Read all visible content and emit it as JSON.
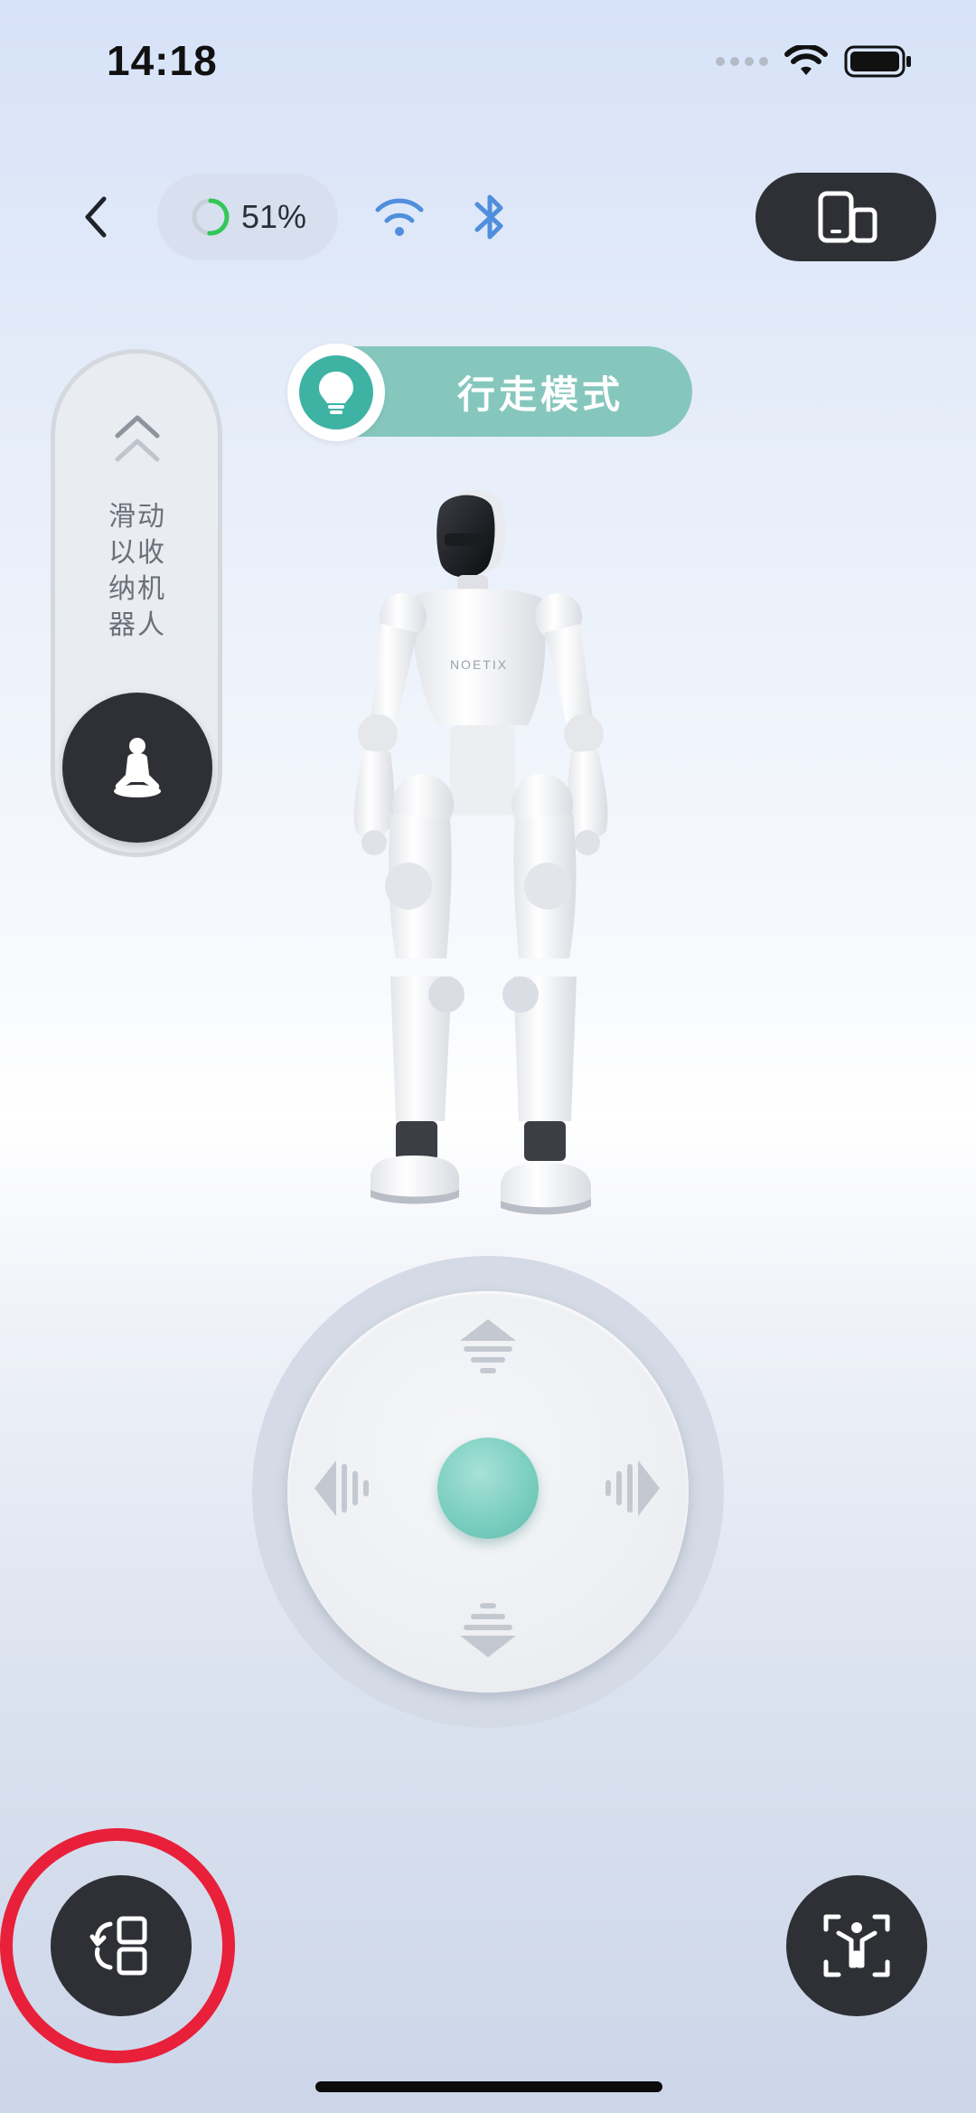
{
  "status_bar": {
    "time": "14:18"
  },
  "top_bar": {
    "battery_percent": 51,
    "battery_label": "51%",
    "wifi_color": "#4f8fdc",
    "bluetooth_color": "#4f8fdc",
    "battery_ring_color": "#34c759"
  },
  "mode": {
    "label": "行走模式",
    "accent": "#3fb3a3",
    "pill_color": "#86c7bd"
  },
  "stow_slider": {
    "lines": [
      "滑动",
      "以收",
      "纳机",
      "器人"
    ]
  },
  "robot": {
    "brand": "NOETIX"
  },
  "joystick": {
    "center_color": "#7ccfc1"
  }
}
